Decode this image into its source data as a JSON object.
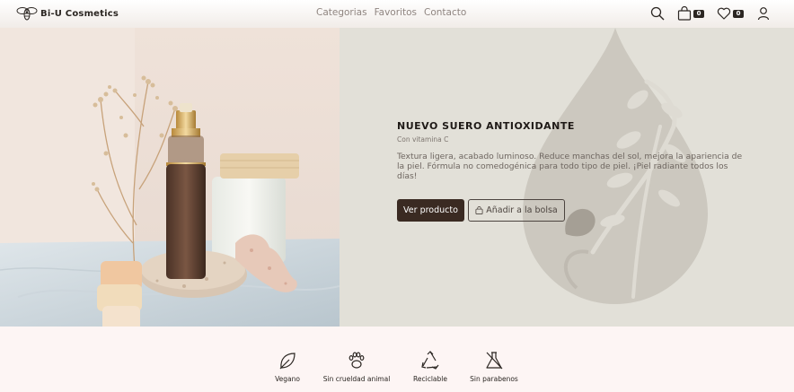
{
  "brand": {
    "name": "Bi-U Cosmetics"
  },
  "nav": [
    {
      "label": "Categorias"
    },
    {
      "label": "Favoritos"
    },
    {
      "label": "Contacto"
    }
  ],
  "header_icons": {
    "cart_count": "0",
    "favorites_count": "0"
  },
  "hero": {
    "title": "NUEVO SUERO ANTIOXIDANTE",
    "subtitle": "Con vitamina C",
    "description": "Textura ligera, acabado luminoso. Reduce manchas del sol, mejora la apariencia de la piel. Fórmula no comedogénica para todo tipo de piel. ¡Piel radiante todos los días!",
    "primary_button": "Ver producto",
    "secondary_button": "Añadir a la bolsa"
  },
  "features": [
    {
      "label": "Vegano",
      "icon": "leaf-icon"
    },
    {
      "label": "Sin crueldad animal",
      "icon": "paw-icon"
    },
    {
      "label": "Reciclable",
      "icon": "recycle-icon"
    },
    {
      "label": "Sin parabenos",
      "icon": "no-flask-icon"
    }
  ],
  "colors": {
    "primary_button": "#3a2a22",
    "hero_bg": "#e2e0d8",
    "footer_bg": "#fdf5f4"
  }
}
